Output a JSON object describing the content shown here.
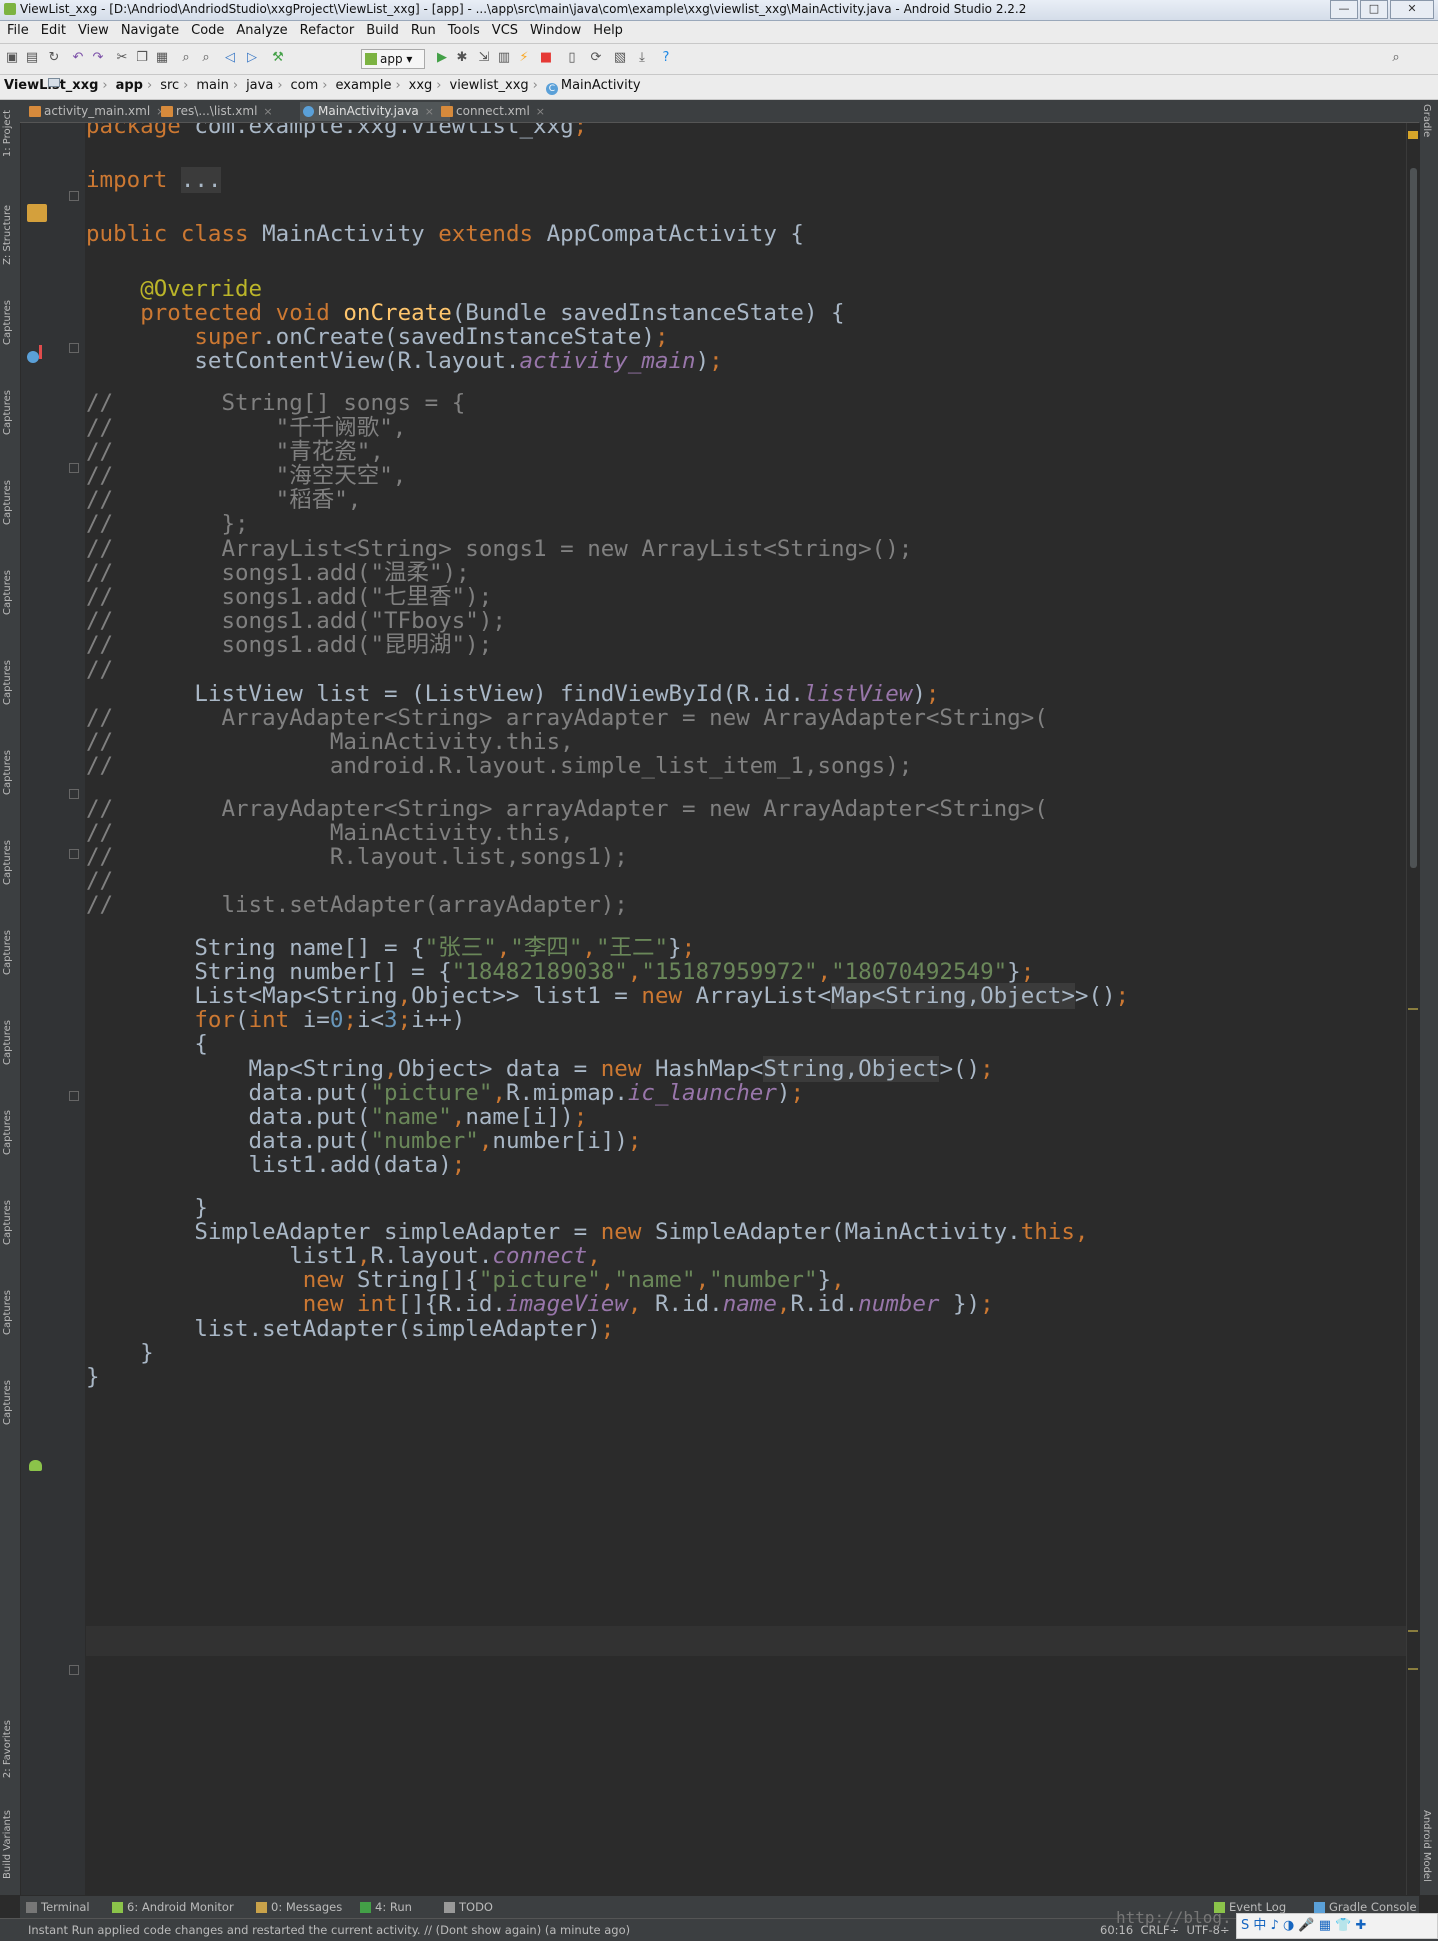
{
  "window": {
    "title": "ViewList_xxg - [D:\\Andriod\\AndriodStudio\\xxgProject\\ViewList_xxg] - [app] - ...\\app\\src\\main\\java\\com\\example\\xxg\\viewlist_xxg\\MainActivity.java - Android Studio 2.2.2",
    "minimize": "—",
    "maximize": "□",
    "close": "✕"
  },
  "menu": [
    "File",
    "Edit",
    "View",
    "Navigate",
    "Code",
    "Analyze",
    "Refactor",
    "Build",
    "Run",
    "Tools",
    "VCS",
    "Window",
    "Help"
  ],
  "toolbar": {
    "run_config": "app",
    "icons": [
      "open-icon",
      "save-icon",
      "sync-icon",
      "undo-icon",
      "redo-icon",
      "cut-icon",
      "copy-icon",
      "paste-icon",
      "find-icon",
      "replace-icon",
      "back-icon",
      "forward-icon",
      "make-icon",
      "run-icon",
      "debug-icon",
      "attach-icon",
      "profile-icon",
      "apply-changes-icon",
      "stop-icon",
      "avd-manager-icon",
      "sync-gradle-icon",
      "project-structure-icon",
      "sdk-manager-icon",
      "help-icon",
      "search-everywhere-icon"
    ]
  },
  "breadcrumb": [
    "ViewList_xxg",
    "app",
    "src",
    "main",
    "java",
    "com",
    "example",
    "xxg",
    "viewlist_xxg",
    "MainActivity"
  ],
  "tabs": [
    {
      "label": "activity_main.xml",
      "type": "xml"
    },
    {
      "label": "res\\...\\list.xml",
      "type": "xml"
    },
    {
      "label": "MainActivity.java",
      "type": "java",
      "active": true
    },
    {
      "label": "connect.xml",
      "type": "xml"
    }
  ],
  "left_tools": [
    "1: Project",
    "Z: Structure",
    "Captures",
    "Captures",
    "Captures",
    "Captures",
    "Captures",
    "Captures",
    "Captures",
    "Captures",
    "Captures",
    "Captures",
    "Captures",
    "Captures",
    "Captures",
    "2: Favorites",
    "Build Variants"
  ],
  "right_tools": [
    "Gradle",
    "Android Model"
  ],
  "colors": {
    "keyword": "#cc7832",
    "string": "#6a8759",
    "comment": "#808080",
    "annotation": "#bbb529",
    "field": "#9876aa",
    "method": "#ffc66d",
    "number": "#6897bb",
    "text": "#a9b7c6"
  },
  "code_lines": [
    [
      [
        "k",
        "package"
      ],
      [
        "t",
        " com.example.xxg.viewlist_xxg"
      ],
      [
        "k",
        ";"
      ]
    ],
    [],
    [
      [
        "k",
        "import"
      ],
      [
        "t",
        " "
      ],
      [
        "g",
        "..."
      ]
    ],
    [],
    [
      [
        "k",
        "public class"
      ],
      [
        "t",
        " MainActivity "
      ],
      [
        "k",
        "extends"
      ],
      [
        "t",
        " AppCompatActivity {"
      ]
    ],
    [],
    [
      [
        "t",
        "    "
      ],
      [
        "a",
        "@Override"
      ]
    ],
    [
      [
        "t",
        "    "
      ],
      [
        "k",
        "protected void"
      ],
      [
        "t",
        " "
      ],
      [
        "m",
        "onCreate"
      ],
      [
        "t",
        "(Bundle savedInstanceState) {"
      ]
    ],
    [
      [
        "t",
        "        "
      ],
      [
        "k",
        "super"
      ],
      [
        "t",
        ".onCreate(savedInstanceState)"
      ],
      [
        "k",
        ";"
      ]
    ],
    [
      [
        "t",
        "        setContentView(R.layout."
      ],
      [
        "f",
        "activity_main"
      ],
      [
        "t",
        ")"
      ],
      [
        "k",
        ";"
      ]
    ],
    [],
    [
      [
        "c",
        "//        String[] songs = {"
      ]
    ],
    [
      [
        "c",
        "//            \"千千阙歌\","
      ]
    ],
    [
      [
        "c",
        "//            \"青花瓷\","
      ]
    ],
    [
      [
        "c",
        "//            \"海空天空\","
      ]
    ],
    [
      [
        "c",
        "//            \"稻香\","
      ]
    ],
    [
      [
        "c",
        "//        };"
      ]
    ],
    [
      [
        "c",
        "//        ArrayList<String> songs1 = new ArrayList<String>();"
      ]
    ],
    [
      [
        "c",
        "//        songs1.add(\"温柔\");"
      ]
    ],
    [
      [
        "c",
        "//        songs1.add(\"七里香\");"
      ]
    ],
    [
      [
        "c",
        "//        songs1.add(\"TFboys\");"
      ]
    ],
    [
      [
        "c",
        "//        songs1.add(\"昆明湖\");"
      ]
    ],
    [
      [
        "c",
        "//"
      ]
    ],
    [
      [
        "t",
        "        ListView list = (ListView) findViewById(R.id."
      ],
      [
        "f",
        "listView"
      ],
      [
        "t",
        ")"
      ],
      [
        "k",
        ";"
      ]
    ],
    [
      [
        "c",
        "//        ArrayAdapter<String> arrayAdapter = new ArrayAdapter<String>("
      ]
    ],
    [
      [
        "c",
        "//                MainActivity.this,"
      ]
    ],
    [
      [
        "c",
        "//                android.R.layout.simple_list_item_1,songs);"
      ]
    ],
    [],
    [
      [
        "c",
        "//        ArrayAdapter<String> arrayAdapter = new ArrayAdapter<String>("
      ]
    ],
    [
      [
        "c",
        "//                MainActivity.this,"
      ]
    ],
    [
      [
        "c",
        "//                R.layout.list,songs1);"
      ]
    ],
    [
      [
        "c",
        "//"
      ]
    ],
    [
      [
        "c",
        "//        list.setAdapter(arrayAdapter);"
      ]
    ],
    [],
    [
      [
        "t",
        "        String name[] = {"
      ],
      [
        "s",
        "\"张三\""
      ],
      [
        "k",
        ","
      ],
      [
        "s",
        "\"李四\""
      ],
      [
        "k",
        ","
      ],
      [
        "s",
        "\"王二\""
      ],
      [
        "t",
        "}"
      ],
      [
        "k",
        ";"
      ]
    ],
    [
      [
        "t",
        "        String number[] = {"
      ],
      [
        "s",
        "\"18482189038\""
      ],
      [
        "k",
        ","
      ],
      [
        "s",
        "\"15187959972\""
      ],
      [
        "k",
        ","
      ],
      [
        "s",
        "\"18070492549\""
      ],
      [
        "t",
        "}"
      ],
      [
        "k",
        ";"
      ]
    ],
    [
      [
        "t",
        "        List<Map<String"
      ],
      [
        "k",
        ","
      ],
      [
        "t",
        "Object>> list1 = "
      ],
      [
        "k",
        "new"
      ],
      [
        "t",
        " ArrayList<"
      ],
      [
        "g",
        "Map<String,Object>"
      ],
      [
        "t",
        ">()"
      ],
      [
        "k",
        ";"
      ]
    ],
    [
      [
        "t",
        "        "
      ],
      [
        "k",
        "for"
      ],
      [
        "t",
        "("
      ],
      [
        "k",
        "int"
      ],
      [
        "t",
        " i="
      ],
      [
        "n",
        "0"
      ],
      [
        "k",
        ";"
      ],
      [
        "t",
        "i<"
      ],
      [
        "n",
        "3"
      ],
      [
        "k",
        ";"
      ],
      [
        "t",
        "i++)"
      ]
    ],
    [
      [
        "t",
        "        {"
      ]
    ],
    [
      [
        "t",
        "            Map<String"
      ],
      [
        "k",
        ","
      ],
      [
        "t",
        "Object> data = "
      ],
      [
        "k",
        "new"
      ],
      [
        "t",
        " HashMap<"
      ],
      [
        "g",
        "String,Object"
      ],
      [
        "t",
        ">()"
      ],
      [
        "k",
        ";"
      ]
    ],
    [
      [
        "t",
        "            data.put("
      ],
      [
        "s",
        "\"picture\""
      ],
      [
        "k",
        ","
      ],
      [
        "t",
        "R.mipmap."
      ],
      [
        "f",
        "ic_launcher"
      ],
      [
        "t",
        ")"
      ],
      [
        "k",
        ";"
      ]
    ],
    [
      [
        "t",
        "            data.put("
      ],
      [
        "s",
        "\"name\""
      ],
      [
        "k",
        ","
      ],
      [
        "t",
        "name[i])"
      ],
      [
        "k",
        ";"
      ]
    ],
    [
      [
        "t",
        "            data.put("
      ],
      [
        "s",
        "\"number\""
      ],
      [
        "k",
        ","
      ],
      [
        "t",
        "number[i])"
      ],
      [
        "k",
        ";"
      ]
    ],
    [
      [
        "t",
        "            list1.add(data)"
      ],
      [
        "k",
        ";"
      ]
    ],
    [],
    [
      [
        "t",
        "        }"
      ]
    ],
    [
      [
        "t",
        "        SimpleAdapter simpleAdapter = "
      ],
      [
        "k",
        "new"
      ],
      [
        "t",
        " SimpleAdapter(MainActivity."
      ],
      [
        "k",
        "this,"
      ]
    ],
    [
      [
        "t",
        "               list1"
      ],
      [
        "k",
        ","
      ],
      [
        "t",
        "R.layout."
      ],
      [
        "f",
        "connect"
      ],
      [
        "k",
        ","
      ]
    ],
    [
      [
        "t",
        "                "
      ],
      [
        "k",
        "new"
      ],
      [
        "t",
        " String[]{"
      ],
      [
        "s",
        "\"picture\""
      ],
      [
        "k",
        ","
      ],
      [
        "s",
        "\"name\""
      ],
      [
        "k",
        ","
      ],
      [
        "s",
        "\"number\""
      ],
      [
        "t",
        "}"
      ],
      [
        "k",
        ","
      ]
    ],
    [
      [
        "t",
        "                "
      ],
      [
        "k",
        "new int"
      ],
      [
        "t",
        "[]{R.id."
      ],
      [
        "f",
        "imageView"
      ],
      [
        "k",
        ","
      ],
      [
        "t",
        " R.id."
      ],
      [
        "f",
        "name"
      ],
      [
        "k",
        ","
      ],
      [
        "t",
        "R.id."
      ],
      [
        "f",
        "number"
      ],
      [
        "t",
        " })"
      ],
      [
        "k",
        ";"
      ]
    ],
    [
      [
        "t",
        "        list.setAdapter(simpleAdapter)"
      ],
      [
        "k",
        ";"
      ]
    ],
    [
      [
        "t",
        "    }"
      ]
    ],
    [
      [
        "t",
        "}"
      ]
    ]
  ],
  "bottom_tools": [
    {
      "label": "Terminal",
      "icon": "terminal-icon"
    },
    {
      "label": "6: Android Monitor",
      "icon": "android-monitor-icon"
    },
    {
      "label": "0: Messages",
      "icon": "messages-icon"
    },
    {
      "label": "4: Run",
      "icon": "run-tool-icon"
    },
    {
      "label": "TODO",
      "icon": "todo-icon"
    },
    {
      "label": "Event Log",
      "icon": "event-log-icon"
    },
    {
      "label": "Gradle Console",
      "icon": "gradle-console-icon"
    }
  ],
  "status": {
    "message": "Instant Run applied code changes and restarted the current activity. // (Dont show again) (a minute ago)",
    "position": "60:16",
    "line_sep": "CRLF÷",
    "encoding": "UTF-8÷"
  },
  "watermark": "http://blog.",
  "tray": "S 中 ♪ ◑ 🎤 ▦ 👕 ✚"
}
